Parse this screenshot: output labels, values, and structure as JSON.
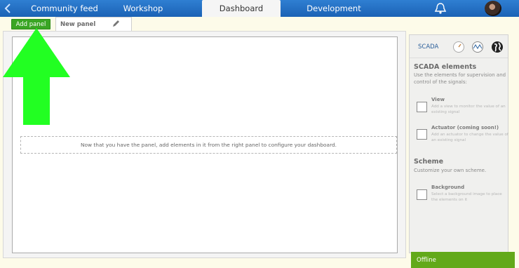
{
  "nav": {
    "tabs": [
      {
        "label": "Community feed"
      },
      {
        "label": "Workshop"
      },
      {
        "label": "Dashboard",
        "active": true
      },
      {
        "label": "Development"
      }
    ]
  },
  "toolbar": {
    "add_panel_label": "Add panel",
    "panel_tab_label": "New panel"
  },
  "canvas": {
    "hint": "Now that you have the panel, add elements in it from the right panel to configure your dashboard."
  },
  "side": {
    "tab_label": "SCADA",
    "icons": [
      "gauge-icon",
      "signal-wave-icon",
      "globe-icon"
    ],
    "scada": {
      "title": "SCADA elements",
      "desc": "Use the elements for supervision and control of the signals:",
      "items": [
        {
          "title": "View",
          "desc": "Add a view to monitor the value of an existing signal"
        },
        {
          "title": "Actuator (coming soon!)",
          "desc": "Add an actuator to change the value of an existing signal"
        }
      ]
    },
    "scheme": {
      "title": "Scheme",
      "desc": "Customize your own scheme.",
      "items": [
        {
          "title": "Background",
          "desc": "Select a background image to place the elements on it"
        }
      ]
    }
  },
  "status": {
    "label": "Offline"
  },
  "colors": {
    "nav": "#1b62b5",
    "add_panel": "#3aa524",
    "arrow": "#22ff22",
    "offline": "#62a91a"
  }
}
